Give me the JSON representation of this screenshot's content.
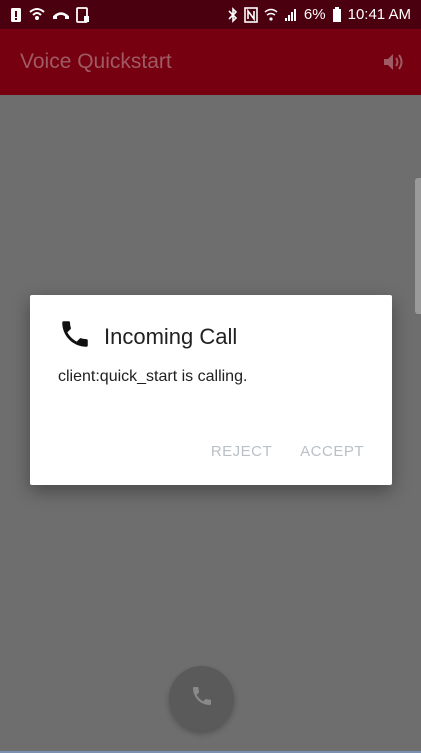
{
  "status_bar": {
    "battery_percent": "6%",
    "time": "10:41 AM",
    "left_icons": [
      "alert-icon",
      "wifi-call-icon",
      "missed-call-icon",
      "screenshot-icon"
    ],
    "right_icons": [
      "bluetooth-icon",
      "nfc-icon",
      "wifi-icon",
      "signal-icon",
      "battery-icon"
    ]
  },
  "app_bar": {
    "title": "Voice Quickstart",
    "action_icon": "speaker-icon"
  },
  "dialog": {
    "title": "Incoming Call",
    "icon": "phone-icon",
    "message": "client:quick_start is calling.",
    "reject_label": "REJECT",
    "accept_label": "ACCEPT"
  },
  "fab": {
    "icon": "phone-icon"
  },
  "colors": {
    "status_bar_bg": "#4a000e",
    "app_bar_bg": "#76000f",
    "dim_bg": "#6e6e6e",
    "dialog_bg": "#ffffff",
    "button_text": "#b9c0c6"
  }
}
